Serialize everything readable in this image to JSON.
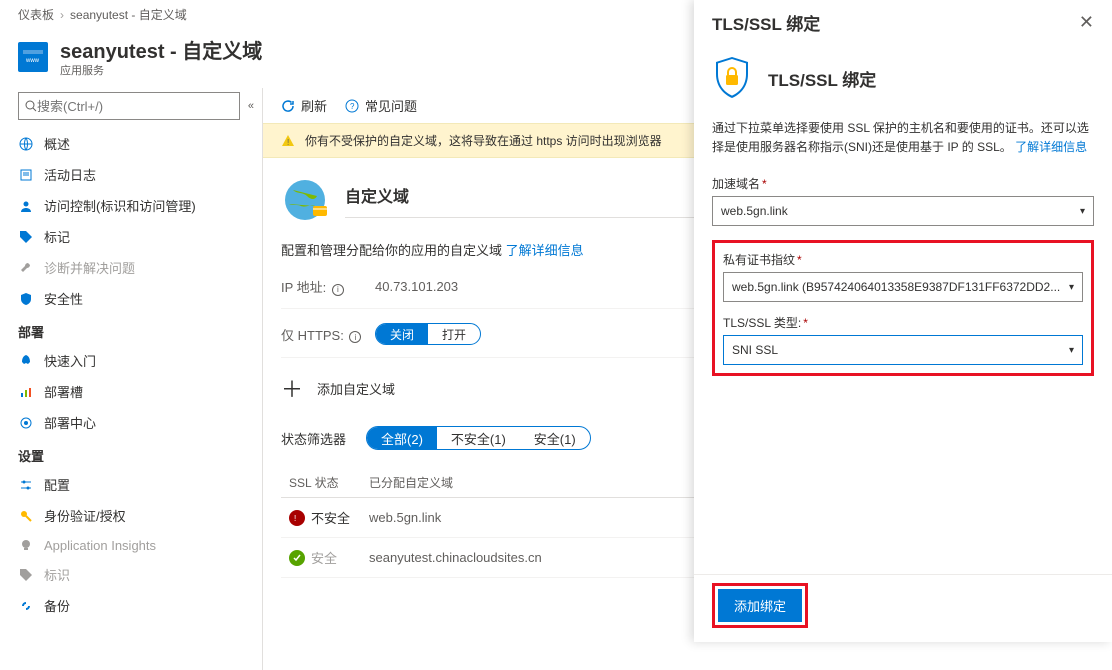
{
  "breadcrumb": {
    "root": "仪表板",
    "leaf": "seanyutest - 自定义域"
  },
  "header": {
    "title": "seanyutest - 自定义域",
    "subtitle": "应用服务"
  },
  "search": {
    "placeholder": "搜索(Ctrl+/)"
  },
  "nav": {
    "core": [
      {
        "label": "概述"
      },
      {
        "label": "活动日志"
      },
      {
        "label": "访问控制(标识和访问管理)"
      },
      {
        "label": "标记"
      },
      {
        "label": "诊断并解决问题"
      },
      {
        "label": "安全性"
      }
    ],
    "g1": {
      "title": "部署",
      "items": [
        {
          "label": "快速入门"
        },
        {
          "label": "部署槽"
        },
        {
          "label": "部署中心"
        }
      ]
    },
    "g2": {
      "title": "设置",
      "items": [
        {
          "label": "配置"
        },
        {
          "label": "身份验证/授权"
        },
        {
          "label": "Application Insights"
        },
        {
          "label": "标识"
        },
        {
          "label": "备份"
        }
      ]
    }
  },
  "toolbar": {
    "refresh": "刷新",
    "faq": "常见问题"
  },
  "warning": "你有不受保护的自定义域，这将导致在通过 https 访问时出现浏览器",
  "section": {
    "title": "自定义域",
    "desc": "配置和管理分配给你的应用的自定义域",
    "learn": "了解详细信息"
  },
  "rows": {
    "ip_label": "IP 地址:",
    "ip_value": "40.73.101.203",
    "https_label": "仅 HTTPS:",
    "https_off": "关闭",
    "https_on": "打开"
  },
  "add": "添加自定义域",
  "filter": {
    "label": "状态筛选器",
    "all": "全部(2)",
    "insecure": "不安全(1)",
    "secure": "安全(1)"
  },
  "table": {
    "h1": "SSL 状态",
    "h2": "已分配自定义域",
    "r1": {
      "status": "不安全",
      "domain": "web.5gn.link"
    },
    "r2": {
      "status": "安全",
      "domain": "seanyutest.chinacloudsites.cn"
    }
  },
  "panel": {
    "title": "TLS/SSL 绑定",
    "inner_title": "TLS/SSL 绑定",
    "desc": "通过下拉菜单选择要使用 SSL 保护的主机名和要使用的证书。还可以选择是使用服务器名称指示(SNI)还是使用基于 IP 的 SSL。",
    "learn": "了解详细信息",
    "f_host": "加速域名",
    "v_host": "web.5gn.link",
    "f_thumb": "私有证书指纹",
    "v_thumb": "web.5gn.link (B957424064013358E9387DF131FF6372DD2...",
    "f_type": "TLS/SSL 类型:",
    "v_type": "SNI SSL",
    "button": "添加绑定"
  }
}
